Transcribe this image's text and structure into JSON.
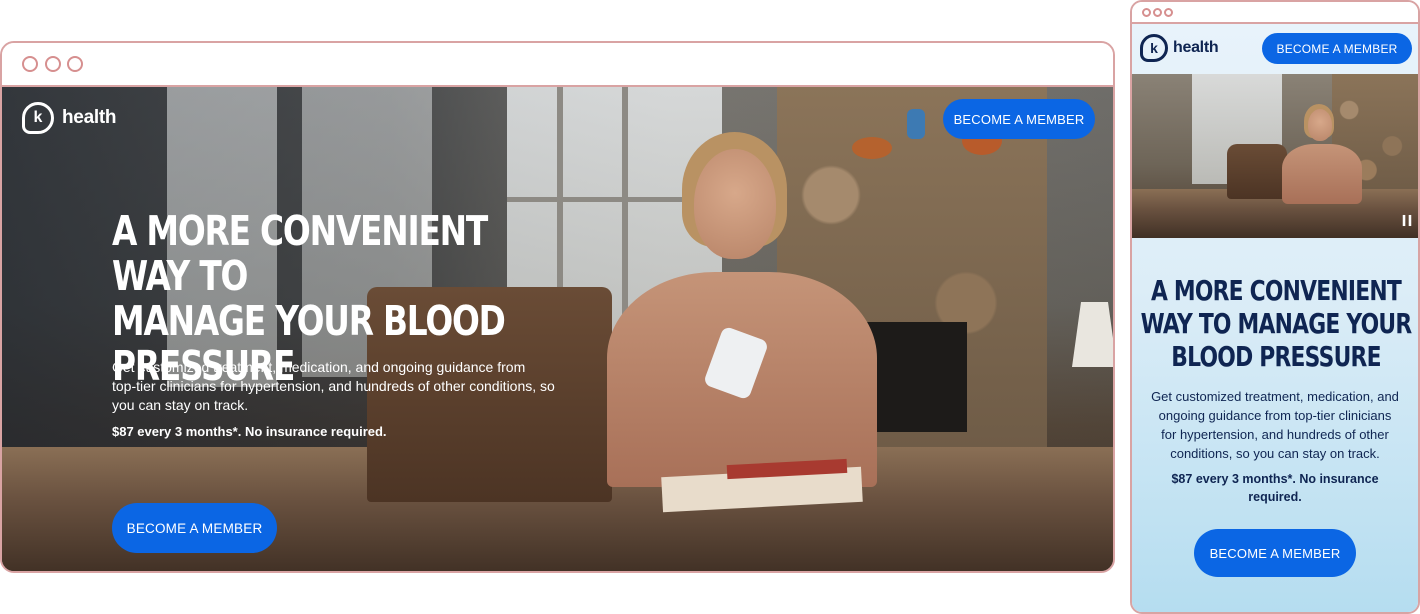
{
  "brand": {
    "logo_letter": "k",
    "name": "health"
  },
  "desktop": {
    "nav_cta": "BECOME A MEMBER",
    "headline": "A MORE CONVENIENT WAY TO MANAGE YOUR BLOOD PRESSURE",
    "headline_lines": [
      "A MORE CONVENIENT WAY TO",
      "MANAGE YOUR BLOOD",
      "PRESSURE"
    ],
    "subtext_lines": [
      "Get customized treatment, medication, and ongoing guidance from",
      "top-tier clinicians for hypertension, and hundreds of other conditions, so",
      "you can stay on track."
    ],
    "price": "$87 every 3 months*. No insurance required.",
    "hero_cta": "BECOME A MEMBER"
  },
  "mobile": {
    "nav_cta": "BECOME A MEMBER",
    "headline_lines": [
      "A MORE CONVENIENT",
      "WAY TO MANAGE YOUR",
      "BLOOD PRESSURE"
    ],
    "subtext_lines": [
      "Get customized treatment, medication, and",
      "ongoing guidance from top-tier clinicians",
      "for hypertension, and hundreds of other",
      "conditions, so you can stay on track."
    ],
    "price_lines": [
      "$87 every 3 months*. No insurance",
      "required."
    ],
    "hero_cta": "BECOME A MEMBER"
  },
  "colors": {
    "accent": "#0b66e4",
    "navy": "#0f2552",
    "frame": "#d9a3a3"
  },
  "icons": [
    "pause-icon",
    "k-logo-icon"
  ]
}
